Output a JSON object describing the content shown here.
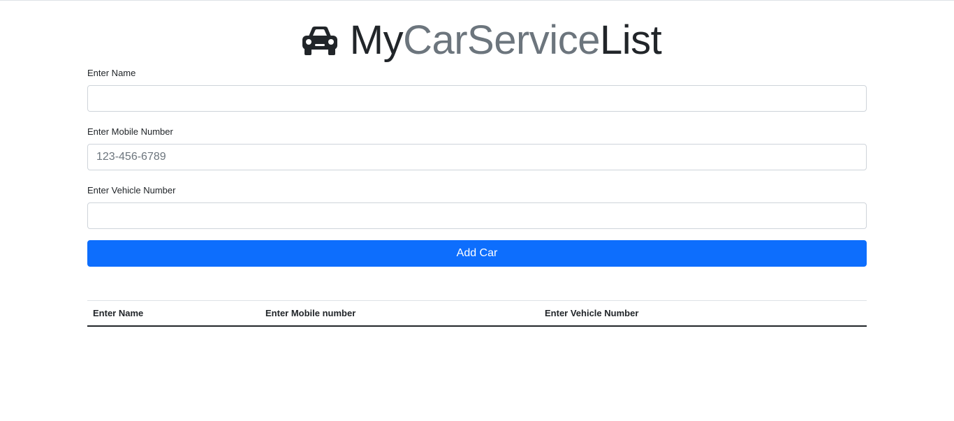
{
  "header": {
    "icon": "car-icon",
    "title_parts": {
      "my": "My",
      "car_service": "CarService",
      "list": "List"
    }
  },
  "form": {
    "name": {
      "label": "Enter Name",
      "value": "",
      "placeholder": ""
    },
    "mobile": {
      "label": "Enter Mobile Number",
      "value": "",
      "placeholder": "123-456-6789"
    },
    "vehicle": {
      "label": "Enter Vehicle Number",
      "value": "",
      "placeholder": ""
    },
    "submit_label": "Add Car"
  },
  "table": {
    "columns": [
      "Enter Name",
      "Enter Mobile number",
      "Enter Vehicle Number"
    ],
    "rows": []
  },
  "colors": {
    "primary": "#0d6efd",
    "text_dark": "#212529",
    "text_muted": "#6c757d",
    "border": "#ced4da"
  }
}
